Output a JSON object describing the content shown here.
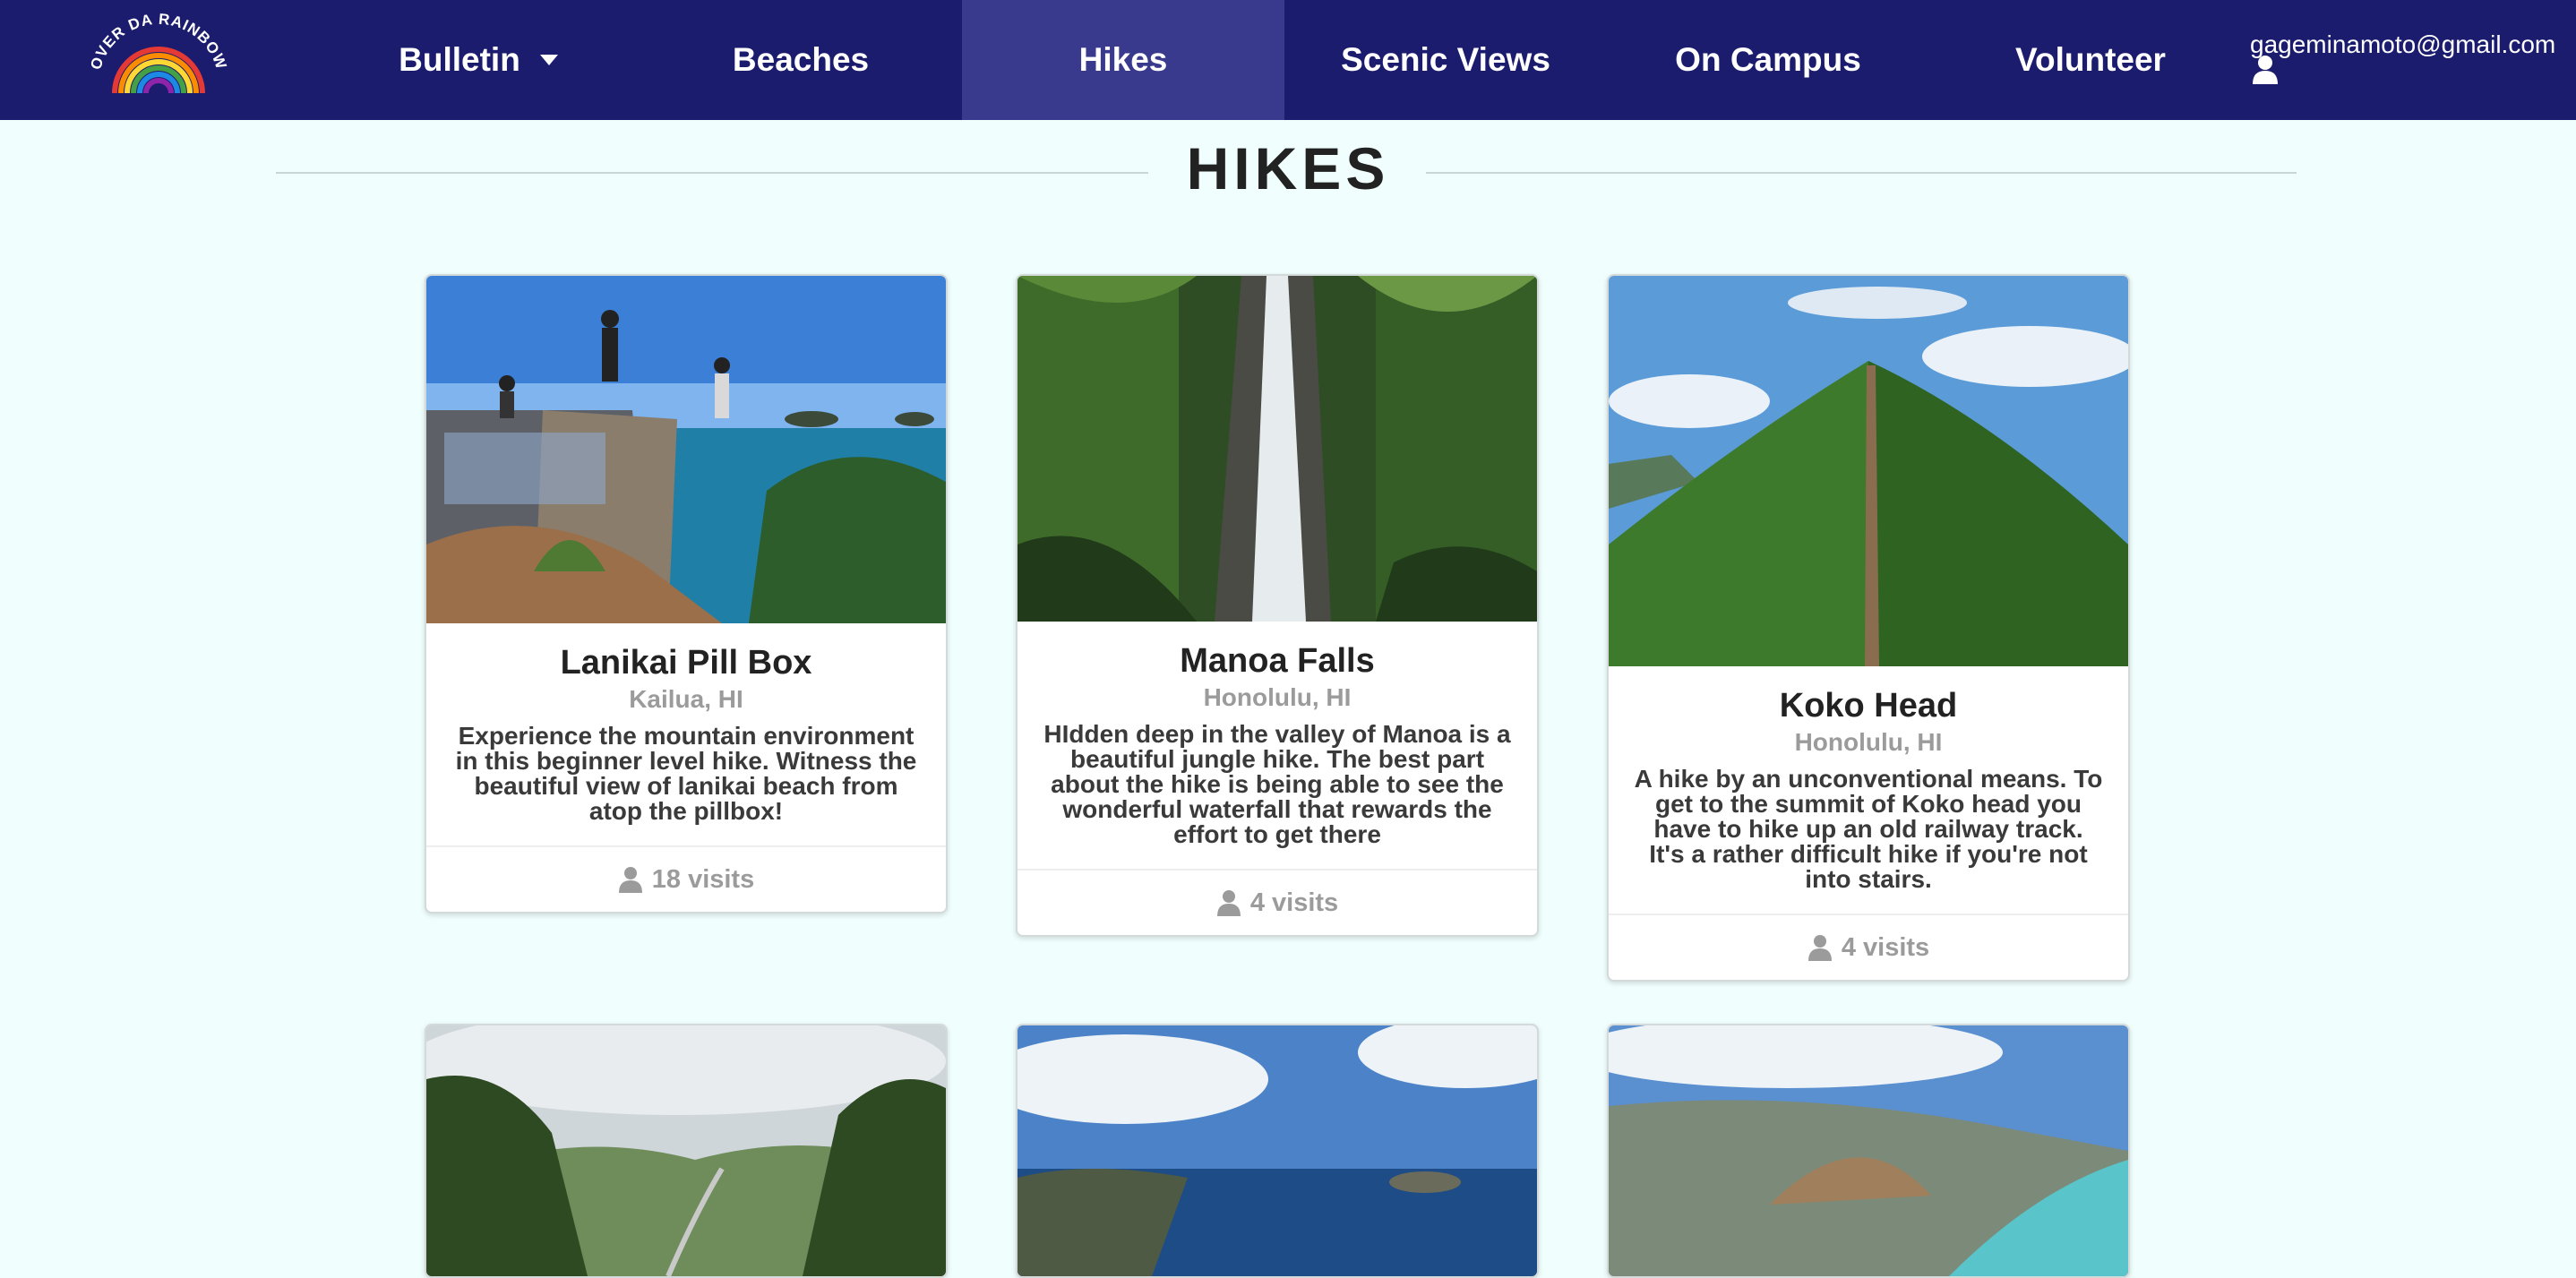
{
  "nav": {
    "logo_text": "OVER DA RAINBOW",
    "items": [
      {
        "label": "Bulletin"
      },
      {
        "label": "Beaches"
      },
      {
        "label": "Hikes"
      },
      {
        "label": "Scenic Views"
      },
      {
        "label": "On Campus"
      },
      {
        "label": "Volunteer"
      }
    ],
    "account": "gageminamoto@gmail.com"
  },
  "page": {
    "title": "HIKES"
  },
  "cards": [
    {
      "title": "Lanikai Pill Box",
      "location": "Kailua, HI",
      "description": "Experience the mountain environment in this beginner level hike. Witness the beautiful view of lanikai beach from atop the pillbox!",
      "visits": "18 visits"
    },
    {
      "title": "Manoa Falls",
      "location": "Honolulu, HI",
      "description": "HIdden deep in the valley of Manoa is a beautiful jungle hike. The best part about the hike is being able to see the wonderful waterfall that rewards the effort to get there",
      "visits": "4 visits"
    },
    {
      "title": "Koko Head",
      "location": "Honolulu, HI",
      "description": "A hike by an unconventional means. To get to the summit of Koko head you have to hike up an old railway track. It's a rather difficult hike if you're not into stairs.",
      "visits": "4 visits"
    }
  ],
  "colors": {
    "nav_bg": "#1b1c6e",
    "nav_active": "#393a8d",
    "page_bg": "#f0fffe"
  }
}
